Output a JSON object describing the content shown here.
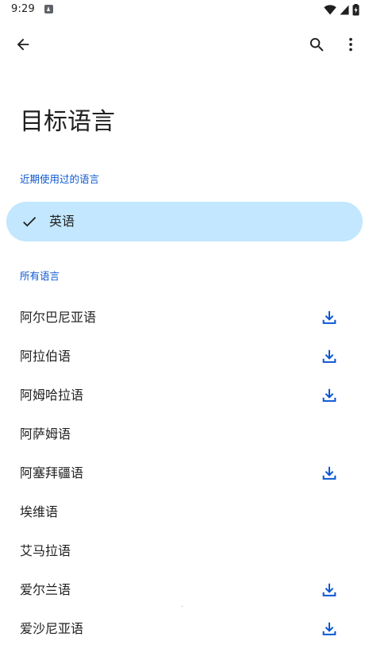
{
  "status_bar": {
    "time": "9:29",
    "app_icon": "a-notification-icon",
    "icons": [
      "wifi-icon",
      "signal-icon",
      "battery-charging-icon"
    ]
  },
  "app_bar": {
    "back_icon": "back-arrow-icon",
    "search_icon": "search-icon",
    "more_icon": "more-vert-icon"
  },
  "title": "目标语言",
  "recent": {
    "header": "近期使用过的语言",
    "items": [
      {
        "label": "英语",
        "selected": true,
        "icon": "check-icon"
      }
    ]
  },
  "all": {
    "header": "所有语言",
    "items": [
      {
        "label": "阿尔巴尼亚语",
        "downloadable": true
      },
      {
        "label": "阿拉伯语",
        "downloadable": true
      },
      {
        "label": "阿姆哈拉语",
        "downloadable": true
      },
      {
        "label": "阿萨姆语",
        "downloadable": false
      },
      {
        "label": "阿塞拜疆语",
        "downloadable": true
      },
      {
        "label": "埃维语",
        "downloadable": false
      },
      {
        "label": "艾马拉语",
        "downloadable": false
      },
      {
        "label": "爱尔兰语",
        "downloadable": true
      },
      {
        "label": "爱沙尼亚语",
        "downloadable": true
      }
    ]
  },
  "colors": {
    "accent": "#0b57d0",
    "selected_bg": "#c2e7ff",
    "text": "#1f1f1f",
    "icon": "#444746"
  }
}
